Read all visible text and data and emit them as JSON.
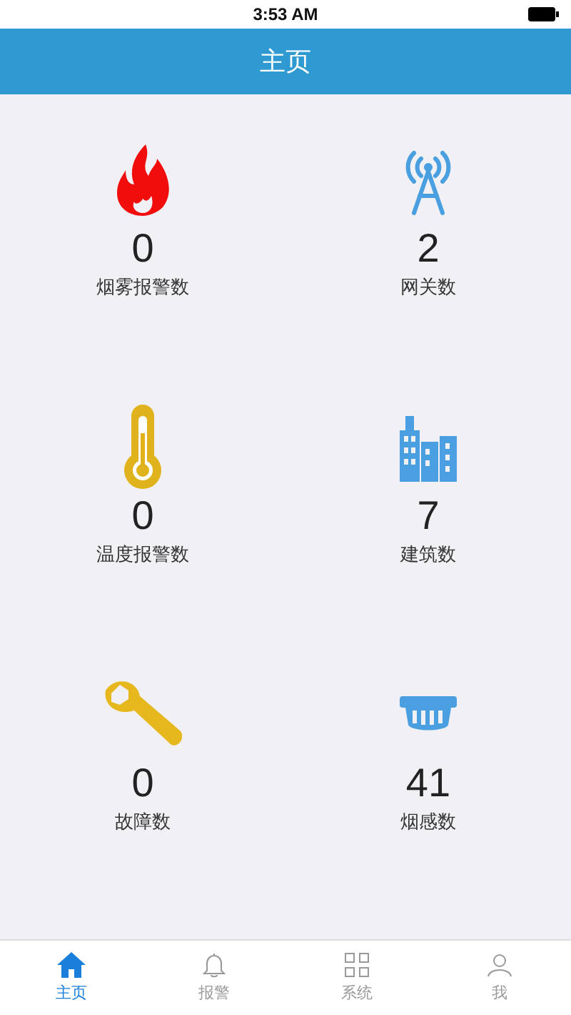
{
  "status_bar": {
    "time": "3:53 AM"
  },
  "header": {
    "title": "主页"
  },
  "stats": [
    {
      "kind": "fire",
      "value": "0",
      "label": "烟雾报警数"
    },
    {
      "kind": "tower",
      "value": "2",
      "label": "网关数"
    },
    {
      "kind": "thermometer",
      "value": "0",
      "label": "温度报警数"
    },
    {
      "kind": "buildings",
      "value": "7",
      "label": "建筑数"
    },
    {
      "kind": "wrench",
      "value": "0",
      "label": "故障数"
    },
    {
      "kind": "detector",
      "value": "41",
      "label": "烟感数"
    }
  ],
  "tab_bar": [
    {
      "kind": "home",
      "label": "主页",
      "selected": true
    },
    {
      "kind": "bell",
      "label": "报警",
      "selected": false
    },
    {
      "kind": "grid",
      "label": "系统",
      "selected": false
    },
    {
      "kind": "person",
      "label": "我",
      "selected": false
    }
  ]
}
